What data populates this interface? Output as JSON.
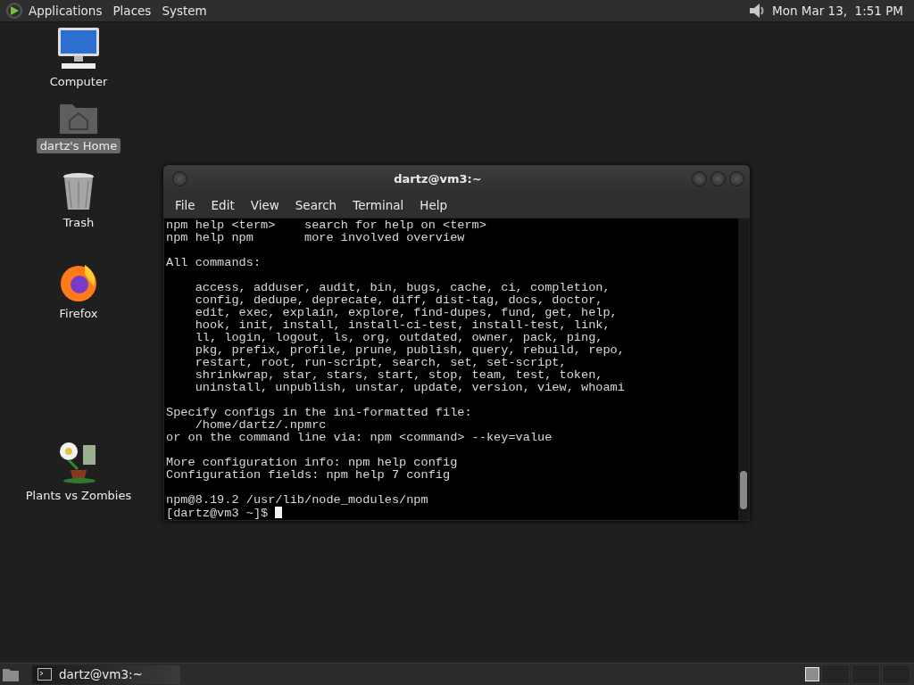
{
  "top_panel": {
    "menus": [
      "Applications",
      "Places",
      "System"
    ],
    "clock": "Mon Mar 13,  1:51 PM"
  },
  "desktop_icons": [
    {
      "kind": "computer",
      "label": "Computer",
      "selected": false
    },
    {
      "kind": "home",
      "label": "dartz's Home",
      "selected": true
    },
    {
      "kind": "trash",
      "label": "Trash",
      "selected": false
    },
    {
      "kind": "firefox",
      "label": "Firefox",
      "selected": false
    },
    {
      "kind": "game",
      "label": "Plants vs Zombies",
      "selected": false
    }
  ],
  "terminal": {
    "title": "dartz@vm3:~",
    "menu": [
      "File",
      "Edit",
      "View",
      "Search",
      "Terminal",
      "Help"
    ],
    "output": [
      [
        "npm help <term>    search for help on <term>",
        "npm help npm       more involved overview"
      ],
      [
        "All commands:"
      ],
      [
        "    access, adduser, audit, bin, bugs, cache, ci, completion,",
        "    config, dedupe, deprecate, diff, dist-tag, docs, doctor,",
        "    edit, exec, explain, explore, find-dupes, fund, get, help,",
        "    hook, init, install, install-ci-test, install-test, link,",
        "    ll, login, logout, ls, org, outdated, owner, pack, ping,",
        "    pkg, prefix, profile, prune, publish, query, rebuild, repo,",
        "    restart, root, run-script, search, set, set-script,",
        "    shrinkwrap, star, stars, start, stop, team, test, token,",
        "    uninstall, unpublish, unstar, update, version, view, whoami"
      ],
      [
        "Specify configs in the ini-formatted file:",
        "    /home/dartz/.npmrc",
        "or on the command line via: npm <command> --key=value"
      ],
      [
        "More configuration info: npm help config",
        "Configuration fields: npm help 7 config"
      ],
      [
        "npm@8.19.2 /usr/lib/node_modules/npm"
      ]
    ],
    "prompt": "[dartz@vm3 ~]$ "
  },
  "taskbar": {
    "windows": [
      {
        "label": "dartz@vm3:~",
        "selected": false
      }
    ],
    "workspaces": [
      {
        "selected": true
      },
      {
        "selected": false
      },
      {
        "selected": false
      },
      {
        "selected": false
      }
    ]
  }
}
